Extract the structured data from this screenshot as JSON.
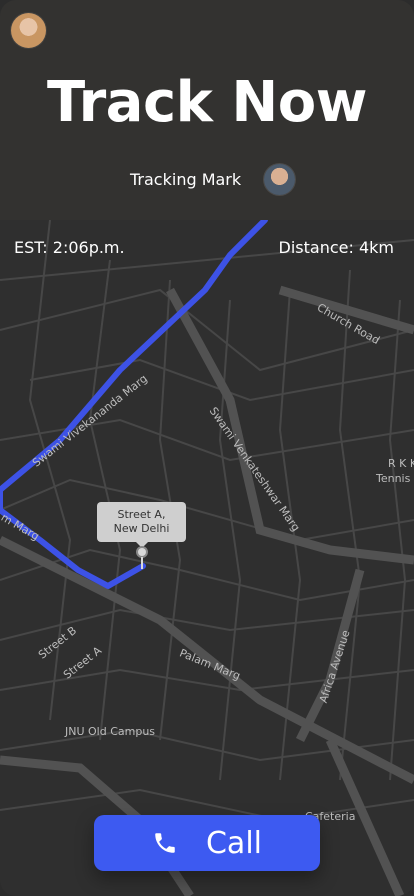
{
  "header": {
    "title": "Track Now",
    "tracking_label": "Tracking Mark",
    "est_text": "EST: 2:06p.m.",
    "distance_text": "Distance: 4km"
  },
  "map": {
    "pin_label_line1": "Street A,",
    "pin_label_line2": "New Delhi",
    "street_labels": [
      "Swami Vivekananda Marg",
      "Swami Venkateshwar Marg",
      "Church Road",
      "Palam Marg",
      "Africa Avenue",
      "Street B",
      "Street A",
      "JNU Old Campus",
      "R K K",
      "Tennis",
      "Cafeteria",
      "m Marg"
    ],
    "route_color": "#3d52e6"
  },
  "actions": {
    "call_label": "Call"
  },
  "colors": {
    "accent": "#3d5af1",
    "background": "#333230"
  }
}
